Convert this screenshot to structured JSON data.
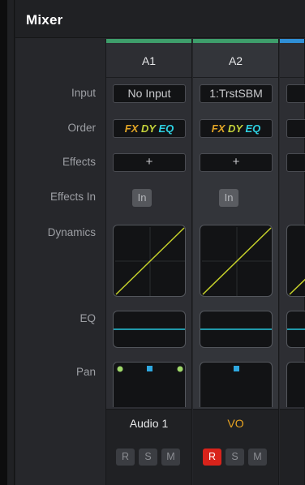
{
  "window": {
    "title": "Mixer"
  },
  "row_labels": {
    "input": "Input",
    "order": "Order",
    "effects": "Effects",
    "effects_in": "Effects In",
    "dynamics": "Dynamics",
    "eq": "EQ",
    "pan": "Pan"
  },
  "strips": [
    {
      "name": "A1",
      "color": "#3e9e6b",
      "input": "No Input",
      "order": {
        "fx": "FX",
        "dy": "DY",
        "eq": "EQ"
      },
      "effects_add": "+",
      "effects_in": "In",
      "track_name": "Audio 1",
      "track_name_color": "#e8e9eb",
      "rsm": {
        "r": "R",
        "s": "S",
        "m": "M",
        "r_armed": false
      }
    },
    {
      "name": "A2",
      "color": "#3e9e6b",
      "input": "1:TrstSBM",
      "order": {
        "fx": "FX",
        "dy": "DY",
        "eq": "EQ"
      },
      "effects_add": "+",
      "effects_in": "In",
      "track_name": "VO",
      "track_name_color": "#e8a321",
      "rsm": {
        "r": "R",
        "s": "S",
        "m": "M",
        "r_armed": true
      }
    },
    {
      "color": "#2f8fd6"
    }
  ],
  "colors": {
    "dynamics_curve": "#c6d12b",
    "eq_curve": "#26c4dc",
    "pan_point": "#2ea8e0",
    "pan_corner_point": "#9fd86a",
    "record_armed": "#d8231b"
  }
}
